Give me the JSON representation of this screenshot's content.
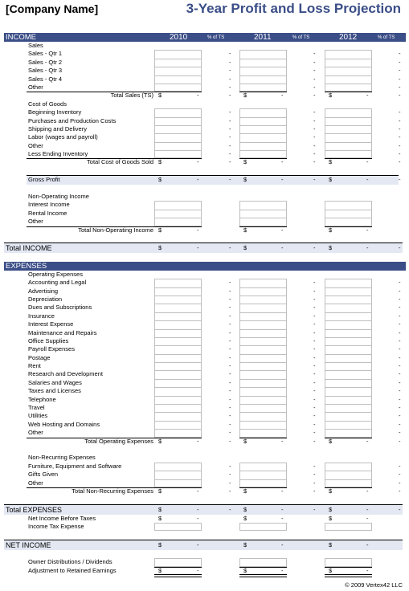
{
  "header": {
    "company": "[Company Name]",
    "title": "3-Year Profit and Loss Projection"
  },
  "years": [
    "2010",
    "2011",
    "2012"
  ],
  "pct_label": "% of TS",
  "income": {
    "section_label": "INCOME",
    "sales_heading": "Sales",
    "sales_items": [
      "Sales - Qtr 1",
      "Sales - Qtr 2",
      "Sales - Qtr 3",
      "Sales - Qtr 4",
      "Other"
    ],
    "total_sales_label": "Total Sales (TS)",
    "cogs_heading": "Cost of Goods",
    "cogs_items": [
      "Beginning Inventory",
      "Purchases and Production Costs",
      "Shipping and Delivery",
      "Labor (wages and payroll)",
      "Other",
      "Less Ending Inventory"
    ],
    "total_cogs_label": "Total Cost of Goods Sold",
    "gross_profit_label": "Gross Profit",
    "nonop_heading": "Non-Operating Income",
    "nonop_items": [
      "Interest Income",
      "Rental Income",
      "Other"
    ],
    "total_nonop_label": "Total Non-Operating Income",
    "total_income_label": "Total INCOME"
  },
  "expenses": {
    "section_label": "EXPENSES",
    "opex_heading": "Operating Expenses",
    "opex_items": [
      "Accounting and Legal",
      "Advertising",
      "Depreciation",
      "Dues and Subscriptions",
      "Insurance",
      "Interest Expense",
      "Maintenance and Repairs",
      "Office Supplies",
      "Payroll Expenses",
      "Postage",
      "Rent",
      "Research and Development",
      "Salaries and Wages",
      "Taxes and Licenses",
      "Telephone",
      "Travel",
      "Utilities",
      "Web Hosting and Domains",
      "Other"
    ],
    "total_opex_label": "Total Operating Expenses",
    "nonrec_heading": "Non-Recurring Expenses",
    "nonrec_items": [
      "Furniture, Equipment and Software",
      "Gifts Given",
      "Other"
    ],
    "total_nonrec_label": "Total Non-Recurring Expenses",
    "total_expenses_label": "Total EXPENSES"
  },
  "summary": {
    "net_before_taxes_label": "Net Income Before Taxes",
    "income_tax_label": "Income Tax Expense",
    "net_income_label": "NET INCOME",
    "owner_dist_label": "Owner Distributions / Dividends",
    "retained_label": "Adjustment to Retained Earnings"
  },
  "values": {
    "currency": "$",
    "empty": "-"
  },
  "footer": {
    "copyright": "© 2009 Vertex42 LLC"
  },
  "colors": {
    "header_band": "#3b4e87",
    "total_band": "#e3e8f3",
    "title": "#3b4e87"
  }
}
